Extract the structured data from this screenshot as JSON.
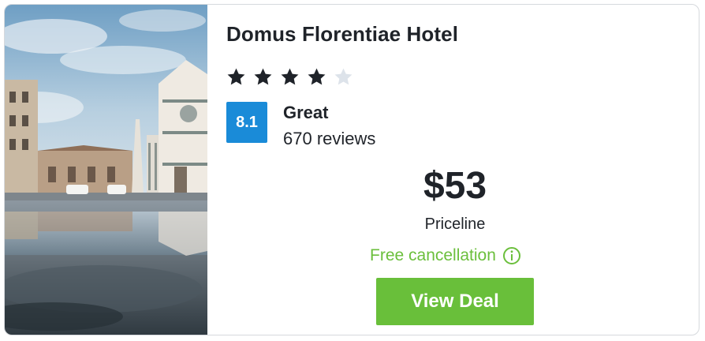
{
  "hotel": {
    "name": "Domus Florentiae Hotel",
    "stars": 4,
    "max_stars": 5,
    "score": "8.1",
    "rating_label": "Great",
    "reviews": "670 reviews",
    "price": "$53",
    "provider": "Priceline",
    "cancellation": "Free cancellation",
    "cta_label": "View Deal"
  },
  "colors": {
    "score_badge": "#1a8bd8",
    "star_filled": "#1f2329",
    "star_empty": "#dde3ea",
    "free_cancellation": "#6bbf3c",
    "cta_button": "#69bf3a"
  },
  "icons": {
    "star": "star-icon",
    "info": "info-circle-icon"
  }
}
